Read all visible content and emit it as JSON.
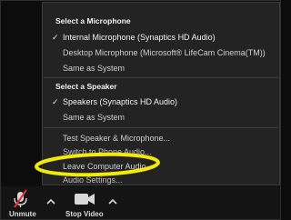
{
  "menu": {
    "microphone_section": {
      "title": "Select a Microphone",
      "items": [
        {
          "label": "Internal Microphone (Synaptics HD Audio)",
          "checked": true
        },
        {
          "label": "Desktop Microphone (Microsoft® LifeCam Cinema(TM))",
          "checked": false
        },
        {
          "label": "Same as System",
          "checked": false
        }
      ]
    },
    "speaker_section": {
      "title": "Select a Speaker",
      "items": [
        {
          "label": "Speakers (Synaptics HD Audio)",
          "checked": true
        },
        {
          "label": "Same as System",
          "checked": false
        }
      ]
    },
    "actions": {
      "test": "Test Speaker & Microphone...",
      "switch_phone": "Switch to Phone Audio...",
      "leave": "Leave Computer Audio",
      "settings": "Audio Settings..."
    }
  },
  "toolbar": {
    "unmute_label": "Unmute",
    "stop_video_label": "Stop Video"
  },
  "colors": {
    "menu_bg": "#232323",
    "highlight": "#f3ea0c",
    "mute_red": "#e5312b"
  },
  "icons": {
    "check": "check-icon",
    "mic_muted": "microphone-muted-icon",
    "video": "video-camera-icon",
    "caret": "chevron-up-icon"
  }
}
